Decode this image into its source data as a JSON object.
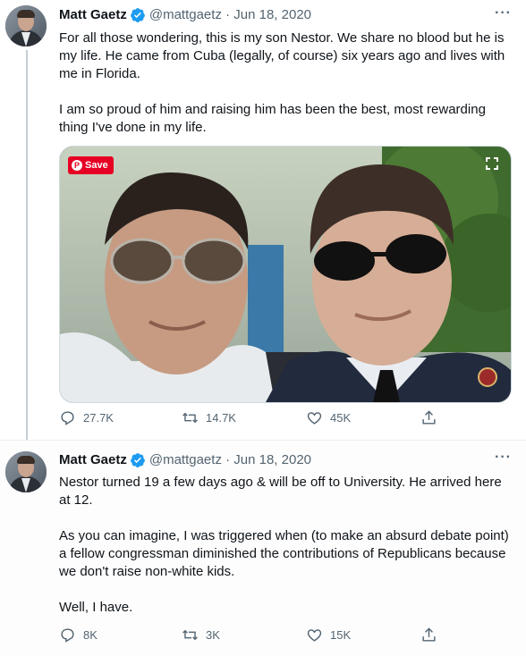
{
  "tweets": [
    {
      "author_name": "Matt Gaetz",
      "handle_date": "@mattgaetz · Jun 18, 2020",
      "more": "···",
      "paragraphs": [
        "For all those wondering, this is my son Nestor.  We share no blood but he is my life. He came from Cuba (legally, of course) six years ago and lives with me in Florida.",
        "I am so proud of him and raising him has been the best, most rewarding thing I've done in my life."
      ],
      "media": {
        "save_label": "Save",
        "pin_glyph": "P"
      },
      "replies": "27.7K",
      "retweets": "14.7K",
      "likes": "45K"
    },
    {
      "author_name": "Matt Gaetz",
      "handle_date": "@mattgaetz · Jun 18, 2020",
      "more": "···",
      "paragraphs": [
        "Nestor turned 19 a few days ago & will be off to University. He arrived here at 12.",
        "As you can imagine, I was triggered when (to make an absurd debate point) a fellow congressman diminished the contributions of Republicans because we don't raise non-white kids.",
        "Well, I have."
      ],
      "replies": "8K",
      "retweets": "3K",
      "likes": "15K"
    }
  ],
  "colors": {
    "accent": "#1d9bf0",
    "muted": "#536471",
    "save_red": "#e60023"
  },
  "icons": [
    "reply-icon",
    "retweet-icon",
    "like-icon",
    "share-icon",
    "verified-icon",
    "expand-icon",
    "pinterest-icon"
  ]
}
